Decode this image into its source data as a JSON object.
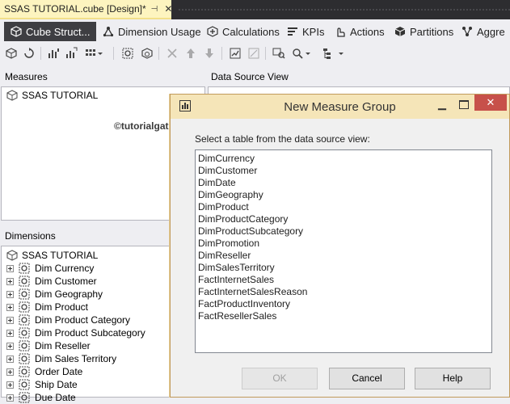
{
  "doc_tab": {
    "title": "SSAS TUTORIAL.cube [Design]*",
    "pin": "⊣",
    "close": "✕"
  },
  "designer_tabs": [
    {
      "label": "Cube Struct...",
      "icon": "cube-structure-icon"
    },
    {
      "label": "Dimension Usage",
      "icon": "dimension-usage-icon"
    },
    {
      "label": "Calculations",
      "icon": "calculations-icon"
    },
    {
      "label": "KPIs",
      "icon": "kpis-icon"
    },
    {
      "label": "Actions",
      "icon": "actions-icon"
    },
    {
      "label": "Partitions",
      "icon": "partitions-icon"
    },
    {
      "label": "Aggre",
      "icon": "aggregations-icon"
    }
  ],
  "measures_pane": {
    "header": "Measures",
    "root": "SSAS TUTORIAL"
  },
  "dsv_pane": {
    "header": "Data Source View"
  },
  "dimensions_pane": {
    "header": "Dimensions",
    "root": "SSAS TUTORIAL",
    "items": [
      "Dim Currency",
      "Dim Customer",
      "Dim Geography",
      "Dim Product",
      "Dim Product Category",
      "Dim Product Subcategory",
      "Dim Reseller",
      "Dim Sales Territory",
      "Order Date",
      "Ship Date",
      "Due Date"
    ]
  },
  "watermark": "©tutorialgateway.org",
  "dialog": {
    "title": "New Measure Group",
    "prompt": "Select a table from the data source view:",
    "tables": [
      "DimCurrency",
      "DimCustomer",
      "DimDate",
      "DimGeography",
      "DimProduct",
      "DimProductCategory",
      "DimProductSubcategory",
      "DimPromotion",
      "DimReseller",
      "DimSalesTerritory",
      "FactInternetSales",
      "FactInternetSalesReason",
      "FactProductInventory",
      "FactResellerSales"
    ],
    "ok": "OK",
    "cancel": "Cancel",
    "help": "Help",
    "minimize": "▁",
    "close": "✕"
  },
  "colors": {
    "tab_active": "#fdf4bf",
    "dialog_title": "#f5e5b8",
    "close_button": "#c7504a",
    "designer_active": "#3e3e42"
  }
}
